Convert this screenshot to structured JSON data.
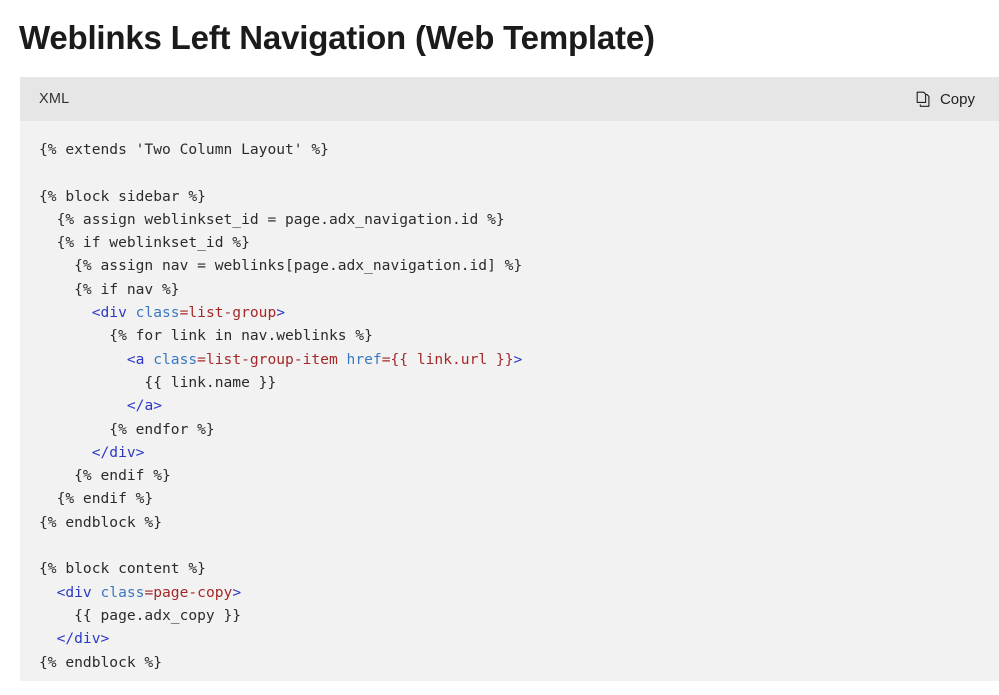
{
  "page": {
    "title": "Weblinks Left Navigation (Web Template)"
  },
  "code_block": {
    "language_label": "XML",
    "copy_label": "Copy",
    "copy_icon": "copy-pages-icon",
    "colors": {
      "header_background": "#e6e6e6",
      "body_background": "#f2f2f2",
      "plain_text": "#2b2b2b",
      "tag": "#2b38c4",
      "attribute": "#3a78c2",
      "value": "#a42828",
      "title_text": "#1b1b1b"
    },
    "lines": [
      [
        {
          "t": "{% extends 'Two Column Layout' %}",
          "c": "plain"
        }
      ],
      [
        {
          "t": "",
          "c": "plain"
        }
      ],
      [
        {
          "t": "{% block sidebar %}",
          "c": "plain"
        }
      ],
      [
        {
          "t": "  {% assign weblinkset_id = page.adx_navigation.id %}",
          "c": "plain"
        }
      ],
      [
        {
          "t": "  {% if weblinkset_id %}",
          "c": "plain"
        }
      ],
      [
        {
          "t": "    {% assign nav = weblinks[page.adx_navigation.id] %}",
          "c": "plain"
        }
      ],
      [
        {
          "t": "    {% if nav %}",
          "c": "plain"
        }
      ],
      [
        {
          "t": "      ",
          "c": "plain"
        },
        {
          "t": "<div",
          "c": "tag"
        },
        {
          "t": " class",
          "c": "attr"
        },
        {
          "t": "=list-group",
          "c": "val"
        },
        {
          "t": ">",
          "c": "tag"
        }
      ],
      [
        {
          "t": "        {% for link in nav.weblinks %}",
          "c": "plain"
        }
      ],
      [
        {
          "t": "          ",
          "c": "plain"
        },
        {
          "t": "<a",
          "c": "tag"
        },
        {
          "t": " class",
          "c": "attr"
        },
        {
          "t": "=list-group-item",
          "c": "val"
        },
        {
          "t": " href",
          "c": "attr"
        },
        {
          "t": "={{ link.url }}",
          "c": "val"
        },
        {
          "t": ">",
          "c": "tag"
        }
      ],
      [
        {
          "t": "            {{ link.name }}",
          "c": "plain"
        }
      ],
      [
        {
          "t": "          ",
          "c": "plain"
        },
        {
          "t": "</a>",
          "c": "tag"
        }
      ],
      [
        {
          "t": "        {% endfor %}",
          "c": "plain"
        }
      ],
      [
        {
          "t": "      ",
          "c": "plain"
        },
        {
          "t": "</div>",
          "c": "tag"
        }
      ],
      [
        {
          "t": "    {% endif %}",
          "c": "plain"
        }
      ],
      [
        {
          "t": "  {% endif %}",
          "c": "plain"
        }
      ],
      [
        {
          "t": "{% endblock %}",
          "c": "plain"
        }
      ],
      [
        {
          "t": "",
          "c": "plain"
        }
      ],
      [
        {
          "t": "{% block content %}",
          "c": "plain"
        }
      ],
      [
        {
          "t": "  ",
          "c": "plain"
        },
        {
          "t": "<div",
          "c": "tag"
        },
        {
          "t": " class",
          "c": "attr"
        },
        {
          "t": "=page-copy",
          "c": "val"
        },
        {
          "t": ">",
          "c": "tag"
        }
      ],
      [
        {
          "t": "    {{ page.adx_copy }}",
          "c": "plain"
        }
      ],
      [
        {
          "t": "  ",
          "c": "plain"
        },
        {
          "t": "</div>",
          "c": "tag"
        }
      ],
      [
        {
          "t": "{% endblock %}",
          "c": "plain"
        }
      ]
    ]
  }
}
